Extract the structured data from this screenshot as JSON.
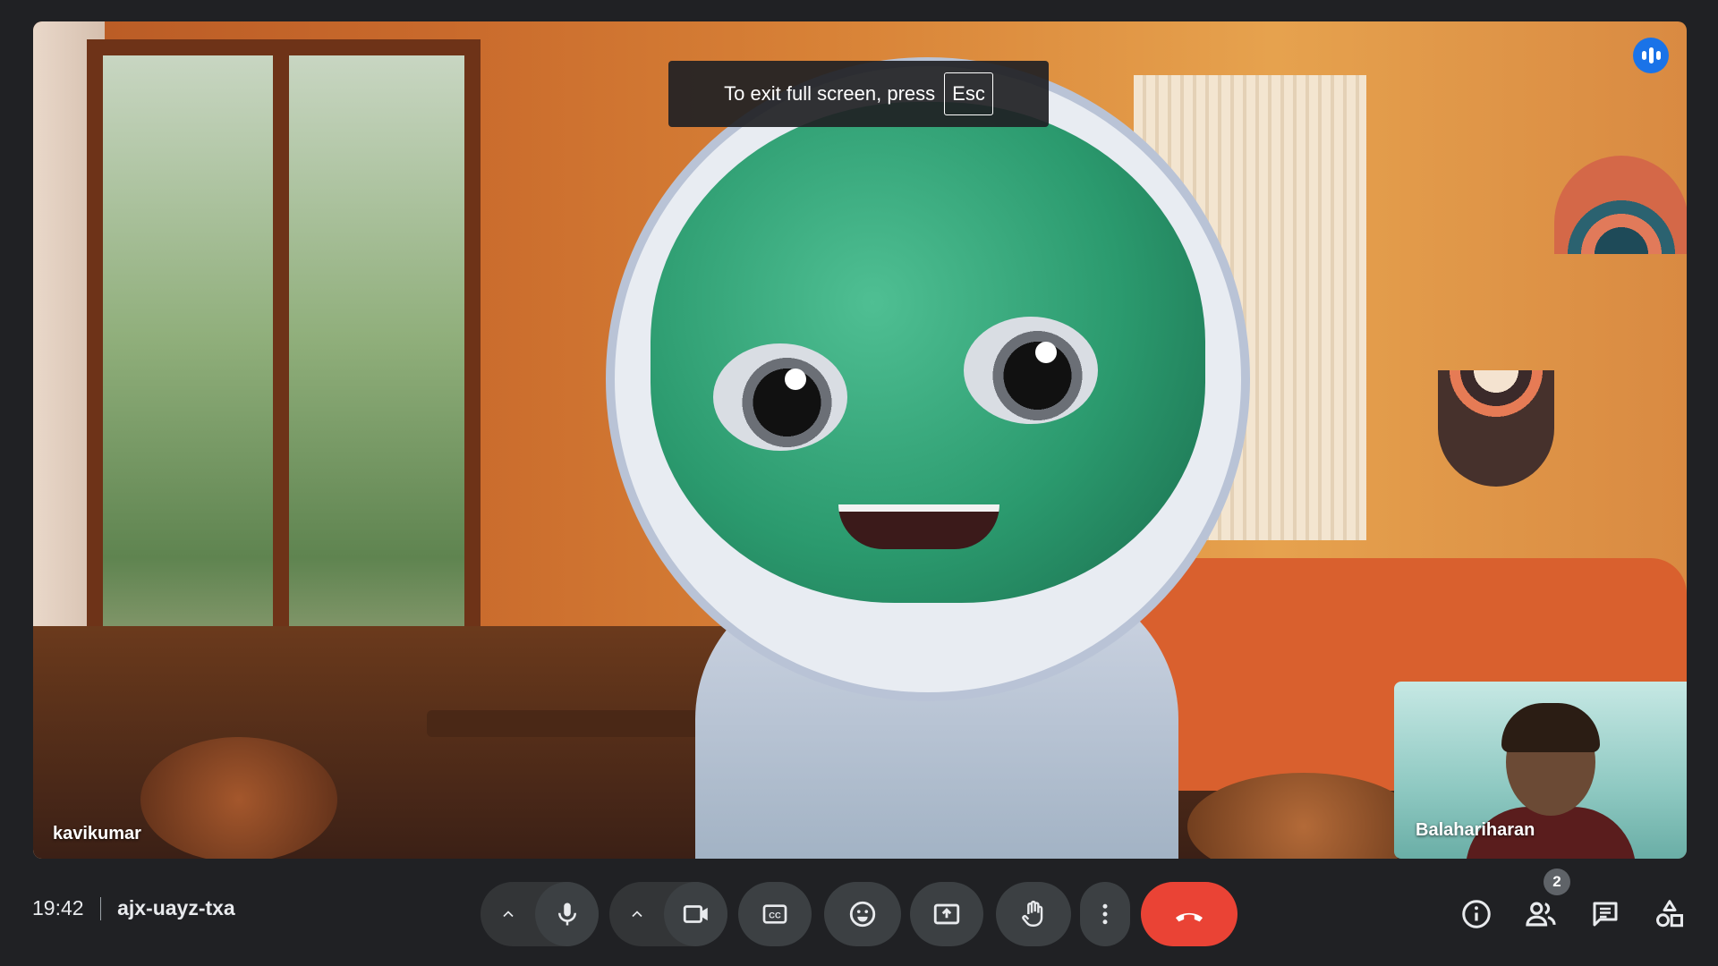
{
  "meeting": {
    "time": "19:42",
    "code": "ajx-uayz-txa"
  },
  "fullscreen_toast": {
    "text": "To exit full screen, press",
    "key": "Esc"
  },
  "participants": {
    "main_name": "kavikumar",
    "self_name": "Balahariharan",
    "count": "2"
  },
  "controls": {
    "icons": [
      "chevron-up-icon",
      "microphone-icon",
      "chevron-up-icon",
      "camera-icon",
      "captions-icon",
      "emoji-icon",
      "present-icon",
      "raise-hand-icon",
      "more-vert-icon",
      "end-call-icon"
    ],
    "side_icons": [
      "info-icon",
      "people-icon",
      "chat-icon",
      "activities-icon"
    ]
  },
  "colors": {
    "background": "#202124",
    "control": "#3c4043",
    "end_call": "#ea4335",
    "speaking": "#1a73e8"
  }
}
